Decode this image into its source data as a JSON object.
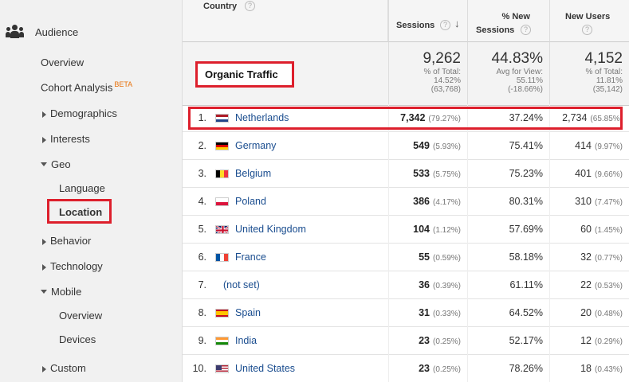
{
  "sidebar": {
    "section": "Audience",
    "items": [
      {
        "label": "Overview"
      },
      {
        "label": "Cohort Analysis",
        "badge": "BETA"
      },
      {
        "label": "Demographics"
      },
      {
        "label": "Interests"
      },
      {
        "label": "Geo"
      },
      {
        "label": "Language"
      },
      {
        "label": "Location"
      },
      {
        "label": "Behavior"
      },
      {
        "label": "Technology"
      },
      {
        "label": "Mobile"
      },
      {
        "label": "Overview"
      },
      {
        "label": "Devices"
      },
      {
        "label": "Custom"
      }
    ]
  },
  "table": {
    "headers": {
      "country": "Country",
      "sessions": "Sessions",
      "new_sessions_1": "% New",
      "new_sessions_2": "Sessions",
      "new_users": "New Users"
    },
    "summary": {
      "label": "Organic Traffic",
      "sessions": {
        "value": "9,262",
        "l1": "% of Total:",
        "l2": "14.52%",
        "l3": "(63,768)"
      },
      "new_sessions": {
        "value": "44.83%",
        "l1": "Avg for View:",
        "l2": "55.11%",
        "l3": "(-18.66%)"
      },
      "new_users": {
        "value": "4,152",
        "l1": "% of Total:",
        "l2": "11.81%",
        "l3": "(35,142)"
      }
    },
    "rows": [
      {
        "idx": "1.",
        "country": "Netherlands",
        "sessions": "7,342",
        "sessions_pct": "(79.27%)",
        "new_pct": "37.24%",
        "new_users": "2,734",
        "new_users_pct": "(65.85%)"
      },
      {
        "idx": "2.",
        "country": "Germany",
        "sessions": "549",
        "sessions_pct": "(5.93%)",
        "new_pct": "75.41%",
        "new_users": "414",
        "new_users_pct": "(9.97%)"
      },
      {
        "idx": "3.",
        "country": "Belgium",
        "sessions": "533",
        "sessions_pct": "(5.75%)",
        "new_pct": "75.23%",
        "new_users": "401",
        "new_users_pct": "(9.66%)"
      },
      {
        "idx": "4.",
        "country": "Poland",
        "sessions": "386",
        "sessions_pct": "(4.17%)",
        "new_pct": "80.31%",
        "new_users": "310",
        "new_users_pct": "(7.47%)"
      },
      {
        "idx": "5.",
        "country": "United Kingdom",
        "sessions": "104",
        "sessions_pct": "(1.12%)",
        "new_pct": "57.69%",
        "new_users": "60",
        "new_users_pct": "(1.45%)"
      },
      {
        "idx": "6.",
        "country": "France",
        "sessions": "55",
        "sessions_pct": "(0.59%)",
        "new_pct": "58.18%",
        "new_users": "32",
        "new_users_pct": "(0.77%)"
      },
      {
        "idx": "7.",
        "country": "(not set)",
        "sessions": "36",
        "sessions_pct": "(0.39%)",
        "new_pct": "61.11%",
        "new_users": "22",
        "new_users_pct": "(0.53%)"
      },
      {
        "idx": "8.",
        "country": "Spain",
        "sessions": "31",
        "sessions_pct": "(0.33%)",
        "new_pct": "64.52%",
        "new_users": "20",
        "new_users_pct": "(0.48%)"
      },
      {
        "idx": "9.",
        "country": "India",
        "sessions": "23",
        "sessions_pct": "(0.25%)",
        "new_pct": "52.17%",
        "new_users": "12",
        "new_users_pct": "(0.29%)"
      },
      {
        "idx": "10.",
        "country": "United States",
        "sessions": "23",
        "sessions_pct": "(0.25%)",
        "new_pct": "78.26%",
        "new_users": "18",
        "new_users_pct": "(0.43%)"
      }
    ]
  },
  "colors": {
    "highlight_red": "#dd1f2c",
    "link_blue": "#1a4d8f"
  }
}
